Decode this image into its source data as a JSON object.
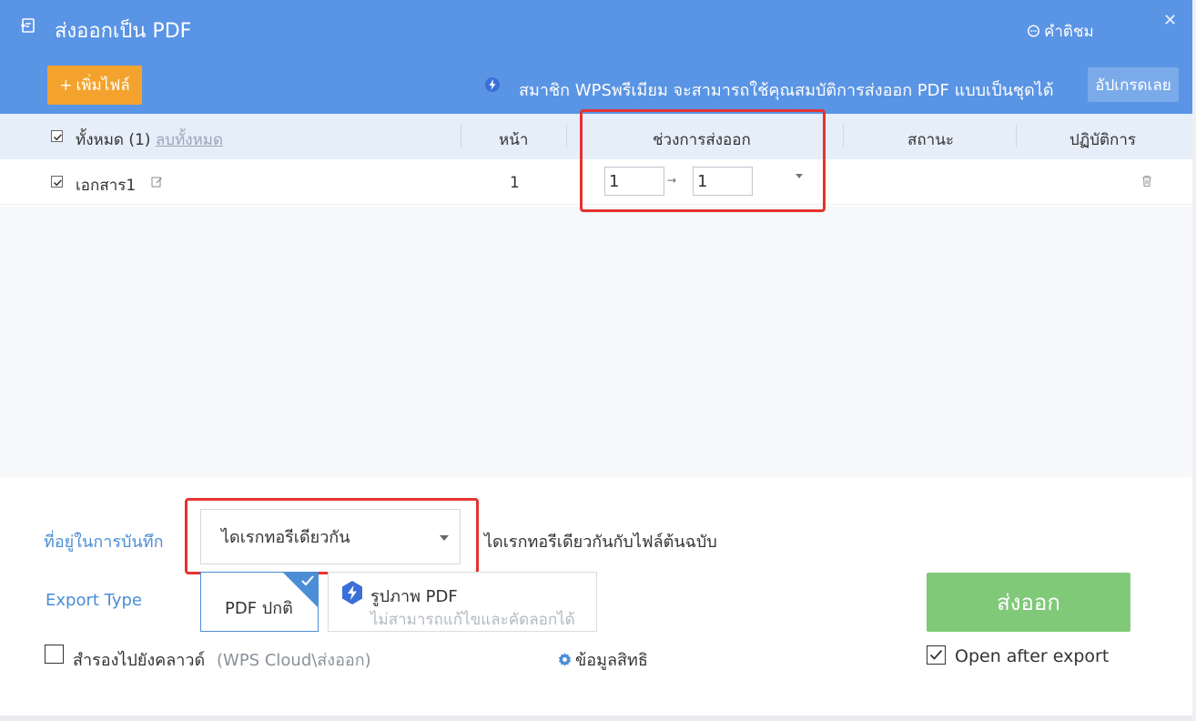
{
  "header": {
    "title": "ส่งออกเป็น PDF",
    "feedback": "คำติชม",
    "add_file": "เพิ่มไฟล์",
    "promo": "สมาชิก WPSพรีเมียม จะสามารถใช้คุณสมบัติการส่งออก PDF แบบเป็นชุดได้",
    "upgrade": "อัปเกรดเลย"
  },
  "table": {
    "headers": {
      "all": "ทั้งหมด (1)",
      "clear_all": "ลบทั้งหมด",
      "pages": "หน้า",
      "range": "ช่วงการส่งออก",
      "status": "สถานะ",
      "actions": "ปฏิบัติการ"
    },
    "rows": [
      {
        "name": "เอกสาร1",
        "pages": "1",
        "range_from": "1",
        "range_to": "1",
        "status": ""
      }
    ]
  },
  "save": {
    "label": "ที่อยู่ในการบันทึก",
    "selected": "ไดเรกทอรีเดียวกัน",
    "description": "ไดเรกทอรีเดียวกันกับไฟล์ต้นฉบับ"
  },
  "export_type": {
    "label": "Export Type",
    "normal": "PDF ปกติ",
    "image_title": "รูปภาพ PDF",
    "image_desc": "ไม่สามารถแก้ไขและคัดลอกได้"
  },
  "cloud": {
    "label": "สำรองไปยังคลาวด์",
    "path": "(WPS Cloud\\ส่งออก)"
  },
  "rights": "ข้อมูลสิทธิ",
  "export_button": "ส่งออก",
  "open_after": "Open after export",
  "colors": {
    "header_bg": "#5a94e4",
    "add_button": "#f3a32d",
    "export_button": "#7fc979",
    "accent": "#4b8ed6",
    "highlight": "#e53330"
  }
}
